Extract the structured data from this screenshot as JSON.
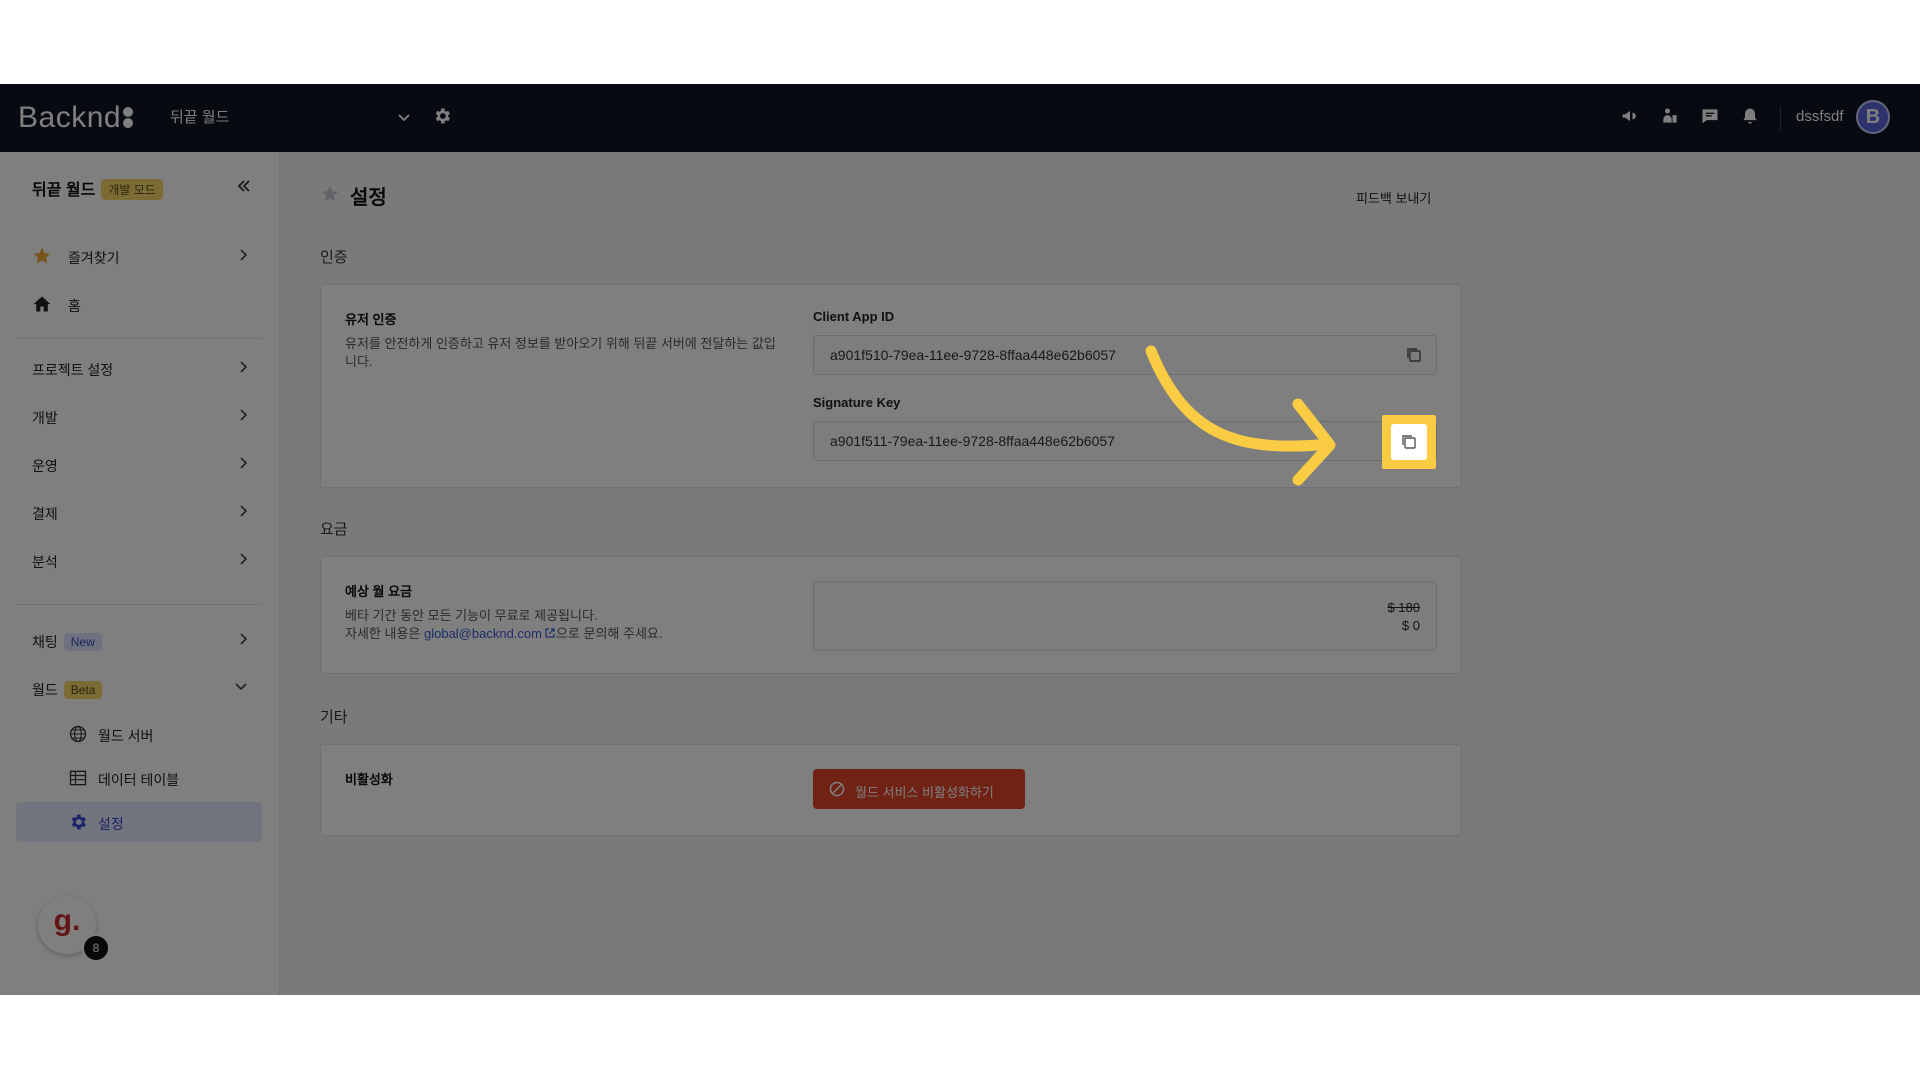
{
  "topbar": {
    "logo": "Backnd",
    "project_name": "뒤끝 월드",
    "username": "dssfsdf",
    "avatar_letter": "B",
    "icons": [
      "megaphone-icon",
      "hands-icon",
      "chat-icon",
      "bell-icon"
    ]
  },
  "sidebar": {
    "title": "뒤끝 월드",
    "mode_badge": "개발 모드",
    "items": [
      {
        "label": "즐겨찾기",
        "icon": "star-icon"
      },
      {
        "label": "홈",
        "icon": "home-icon"
      }
    ],
    "sections": [
      {
        "label": "프로젝트 설정"
      },
      {
        "label": "개발"
      },
      {
        "label": "운영"
      },
      {
        "label": "결제"
      },
      {
        "label": "분석"
      }
    ],
    "chat": {
      "label": "채팅",
      "badge": "New"
    },
    "world": {
      "label": "월드",
      "badge": "Beta"
    },
    "world_sub": [
      {
        "label": "월드 서버",
        "icon": "globe-icon"
      },
      {
        "label": "데이터 테이블",
        "icon": "table-icon"
      },
      {
        "label": "설정",
        "icon": "gear-icon",
        "active": true
      }
    ],
    "assistant": {
      "letter": "g.",
      "count": "8"
    }
  },
  "main": {
    "title": "설정",
    "feedback": "피드백 보내기",
    "auth": {
      "section": "인증",
      "title": "유저 인증",
      "desc": "유저를 안전하게 인증하고 유저 정보를 받아오기 위해 뒤끝 서버에 전달하는 값입니다.",
      "client_app_id_label": "Client App ID",
      "client_app_id": "a901f510-79ea-11ee-9728-8ffaa448e62b6057",
      "signature_key_label": "Signature Key",
      "signature_key": "a901f511-79ea-11ee-9728-8ffaa448e62b6057"
    },
    "pricing": {
      "section": "요금",
      "title": "예상 월 요금",
      "desc1": "베타 기간 동안 모든 기능이 무료로 제공됩니다.",
      "desc2_pre": "자세한 내용은 ",
      "email": "global@backnd.com",
      "desc2_post": "으로 문의해 주세요.",
      "old_price": "$ 180",
      "new_price": "$ 0"
    },
    "other": {
      "section": "기타",
      "title": "비활성화",
      "button": "월드 서비스 비활성화하기"
    }
  },
  "colors": {
    "topbar": "#0f1521",
    "highlight": "#f9cc43",
    "danger": "#e04428",
    "accent": "#3a4ad0"
  }
}
